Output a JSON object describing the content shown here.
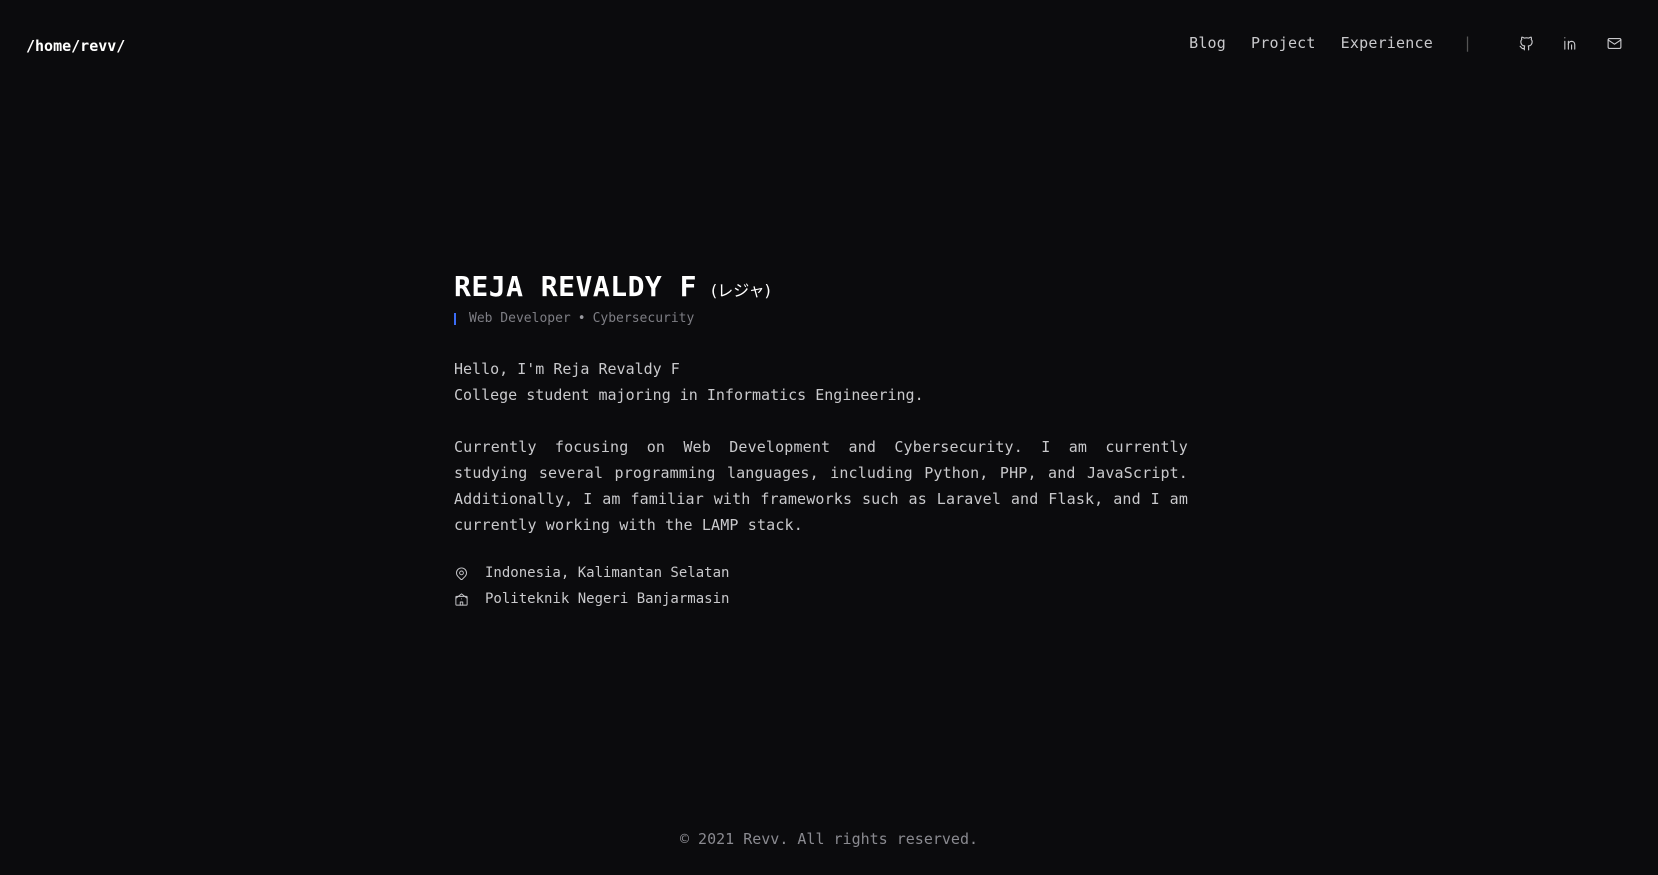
{
  "header": {
    "brand": "/home/revv/",
    "nav": [
      {
        "label": "Blog"
      },
      {
        "label": "Project"
      },
      {
        "label": "Experience"
      }
    ],
    "separator": "|",
    "social_icons": [
      "github-icon",
      "linkedin-icon",
      "mail-icon"
    ]
  },
  "profile": {
    "name": "REJA REVALDY F",
    "name_jp": "(レジャ)",
    "role": "Web Developer",
    "role_dot": "•",
    "focus": "Cybersecurity",
    "accent_color": "#3b6cf6",
    "intro_line1": "Hello, I'm Reja Revaldy F",
    "intro_line2": "College student majoring in Informatics Engineering.",
    "about": "Currently focusing on Web Development and Cybersecurity. I am currently studying several programming languages, including Python, PHP, and JavaScript. Additionally, I am familiar with frameworks such as Laravel and Flask, and I am currently working with the LAMP stack.",
    "location": "Indonesia, Kalimantan Selatan",
    "institution": "Politeknik Negeri Banjarmasin"
  },
  "footer": {
    "copyright": "© 2021 Revv. All rights reserved."
  }
}
